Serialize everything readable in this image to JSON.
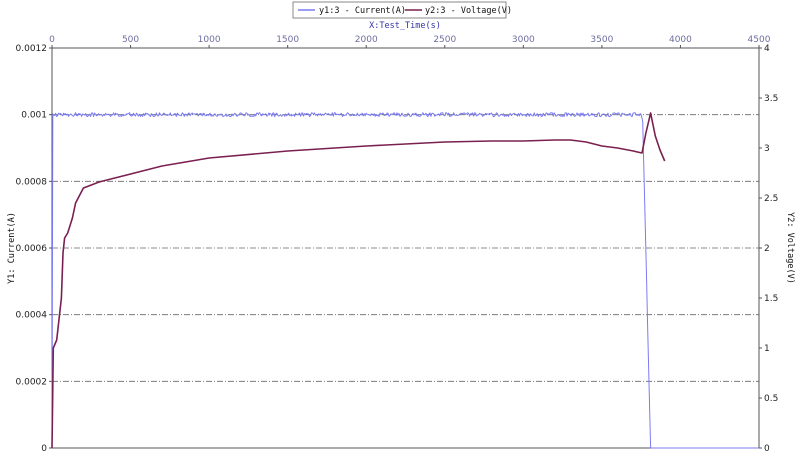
{
  "chart_data": {
    "type": "line",
    "xlabel": "X:Test_Time(s)",
    "y1label": "Y1:  Current(A)",
    "y2label": "Y2:  Voltage(V)",
    "xlim": [
      0,
      4500
    ],
    "y1lim": [
      0,
      0.0012
    ],
    "y2lim": [
      0,
      4
    ],
    "x_ticks": [
      "0",
      "500",
      "1000",
      "1500",
      "2000",
      "2500",
      "3000",
      "3500",
      "4000",
      "4500"
    ],
    "y1_ticks": [
      "0",
      "0.0002",
      "0.0004",
      "0.0006",
      "0.0008",
      "0.001",
      "0.0012"
    ],
    "y2_ticks": [
      "0",
      "0.5",
      "1",
      "1.5",
      "2",
      "2.5",
      "3",
      "3.5",
      "4"
    ],
    "grid": true,
    "legend": "top-center",
    "series": [
      {
        "name": "y1:3 - Current(A)",
        "axis": "y1",
        "color": "#7b7bf2",
        "x": [
          0,
          5,
          10,
          500,
          1000,
          1500,
          2000,
          2500,
          3000,
          3500,
          3750,
          3760,
          3810,
          4500
        ],
        "y": [
          0,
          0.001,
          0.001,
          0.001,
          0.001,
          0.001,
          0.001,
          0.001,
          0.001,
          0.001,
          0.001,
          0.00098,
          0,
          0
        ]
      },
      {
        "name": "y2:3 - Voltage(V)",
        "axis": "y2",
        "color": "#7a2050",
        "x": [
          0,
          8,
          30,
          60,
          70,
          80,
          100,
          130,
          150,
          200,
          250,
          300,
          400,
          500,
          700,
          1000,
          1500,
          2000,
          2500,
          2800,
          3000,
          3200,
          3300,
          3400,
          3500,
          3600,
          3700,
          3755,
          3780,
          3810,
          3840,
          3870,
          3900
        ],
        "y": [
          0,
          1.0,
          1.08,
          1.5,
          1.95,
          2.1,
          2.15,
          2.3,
          2.45,
          2.6,
          2.63,
          2.66,
          2.7,
          2.74,
          2.82,
          2.9,
          2.97,
          3.02,
          3.06,
          3.07,
          3.07,
          3.08,
          3.08,
          3.06,
          3.02,
          3.0,
          2.97,
          2.95,
          3.15,
          3.35,
          3.12,
          2.98,
          2.87
        ]
      }
    ]
  }
}
